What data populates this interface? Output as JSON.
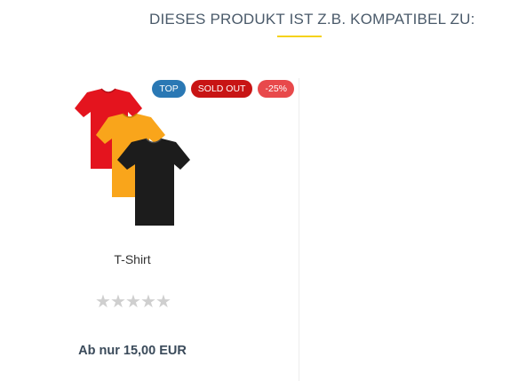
{
  "section": {
    "title": "DIESES PRODUKT IST Z.B. KOMPATIBEL ZU:",
    "accent_color": "#f5d218"
  },
  "product": {
    "badges": {
      "top": "TOP",
      "sold_out": "SOLD OUT",
      "discount": "-25%"
    },
    "image_icon": "tshirt-stack-icon",
    "image_colors": [
      "#e4141e",
      "#f9a51b",
      "#1c1c1c"
    ],
    "name": "T-Shirt",
    "rating": {
      "value": 0,
      "max": 5
    },
    "price": "Ab nur 15,00 EUR"
  }
}
